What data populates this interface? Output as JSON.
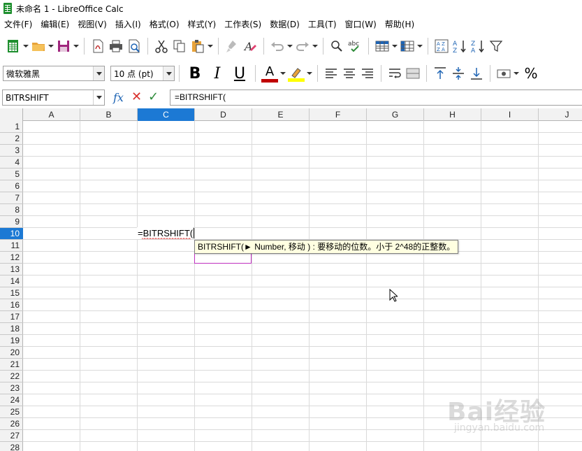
{
  "window": {
    "title": "未命名 1 - LibreOffice Calc"
  },
  "menu": {
    "items": [
      {
        "label": "文件(F)"
      },
      {
        "label": "编辑(E)"
      },
      {
        "label": "视图(V)"
      },
      {
        "label": "插入(I)"
      },
      {
        "label": "格式(O)"
      },
      {
        "label": "样式(Y)"
      },
      {
        "label": "工作表(S)"
      },
      {
        "label": "数据(D)"
      },
      {
        "label": "工具(T)"
      },
      {
        "label": "窗口(W)"
      },
      {
        "label": "帮助(H)"
      }
    ]
  },
  "formatting": {
    "font_name": "微软雅黑",
    "font_size": "10 点 (pt)",
    "bold": "B",
    "italic": "I",
    "underline": "U",
    "font_color": "A",
    "percent": "%",
    "font_color_swatch": "#c00000",
    "highlight_swatch": "#ffff00"
  },
  "formula_bar": {
    "name_box": "BITRSHIFT",
    "formula": "=BITRSHIFT("
  },
  "grid": {
    "columns": [
      "A",
      "B",
      "C",
      "D",
      "E",
      "F",
      "G",
      "H",
      "I",
      "J"
    ],
    "active_column": "C",
    "rows": [
      "1",
      "2",
      "3",
      "4",
      "5",
      "6",
      "7",
      "8",
      "9",
      "10",
      "11",
      "12",
      "13",
      "14",
      "15",
      "16",
      "17",
      "18",
      "19",
      "20",
      "21",
      "22",
      "23",
      "24",
      "25",
      "26",
      "27",
      "28"
    ],
    "active_row": "10",
    "editing_cell_text": "=BITRSHIFT(",
    "tooltip": "BITRSHIFT(► Number, 移动 ) : 要移动的位数。小于 2^48的正整数。"
  },
  "watermark": {
    "text": "Bai经验",
    "url": "jingyan.baidu.com"
  },
  "colors": {
    "accent": "#1c79d4",
    "tooltip_bg": "#ffffe1"
  }
}
